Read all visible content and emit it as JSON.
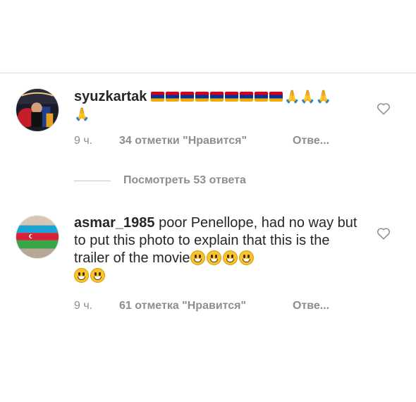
{
  "comments": [
    {
      "username": "syuzkartak",
      "emoji_line": [
        {
          "type": "flag-armenia",
          "count": 9
        },
        {
          "type": "folded-hands",
          "count": 4
        }
      ],
      "time": "9 ч.",
      "likes": "34 отметки \"Нравится\"",
      "reply": "Отве..."
    },
    {
      "username": "asmar_1985",
      "text": " poor Penellope, had no way but to put this photo to explain that this is the trailer of the movie",
      "emoji_line": [
        {
          "type": "grinning-face",
          "count": 6
        }
      ],
      "time": "9 ч.",
      "likes": "61 отметка \"Нравится\"",
      "reply": "Отве..."
    }
  ],
  "view_replies": "Посмотреть 53 ответа",
  "icons": {
    "like": "heart-outline-icon",
    "flag": "armenia-flag-icon",
    "pray": "folded-hands-icon",
    "smile": "grinning-face-icon"
  },
  "colors": {
    "text": "#262626",
    "meta": "#8e8e8e",
    "divider": "#dbdbdb"
  }
}
